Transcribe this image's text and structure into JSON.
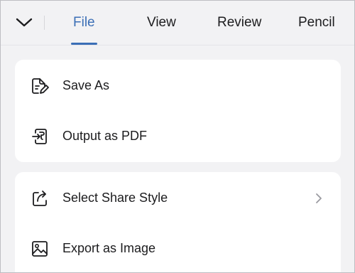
{
  "tabs": [
    {
      "label": "File",
      "active": true
    },
    {
      "label": "View",
      "active": false
    },
    {
      "label": "Review",
      "active": false
    },
    {
      "label": "Pencil",
      "active": false
    }
  ],
  "groups": [
    {
      "items": [
        {
          "label": "Save As",
          "icon": "save-as-icon"
        },
        {
          "label": "Output as PDF",
          "icon": "output-pdf-icon"
        }
      ]
    },
    {
      "items": [
        {
          "label": "Select Share Style",
          "icon": "share-icon",
          "has_chevron": true
        },
        {
          "label": "Export as Image",
          "icon": "image-icon"
        }
      ]
    }
  ],
  "colors": {
    "accent": "#3b6fb6",
    "background": "#f2f2f4",
    "card": "#ffffff",
    "text": "#1c1c1e"
  }
}
